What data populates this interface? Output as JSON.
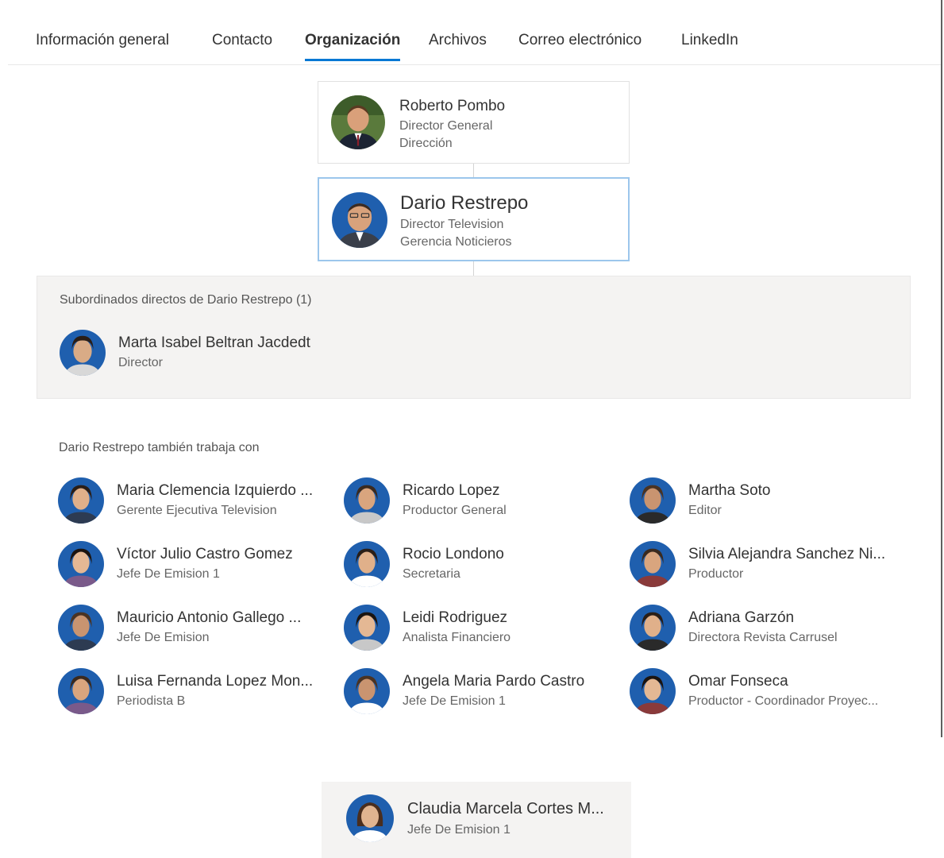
{
  "tabs": [
    {
      "label": "Información general"
    },
    {
      "label": "Contacto"
    },
    {
      "label": "Organización"
    },
    {
      "label": "Archivos"
    },
    {
      "label": "Correo electrónico"
    },
    {
      "label": "LinkedIn"
    }
  ],
  "active_tab": "Organización",
  "manager": {
    "name": "Roberto Pombo",
    "title": "Director General",
    "department": "Dirección"
  },
  "current": {
    "name": "Dario Restrepo",
    "title": "Director Television",
    "department": "Gerencia Noticieros"
  },
  "direct_reports": {
    "heading": "Subordinados directos de Dario Restrepo (1)",
    "items": [
      {
        "name": "Marta Isabel Beltran Jacdedt",
        "role": "Director"
      }
    ]
  },
  "works_with": {
    "heading": "Dario Restrepo también trabaja con",
    "items": [
      {
        "name": "Maria Clemencia Izquierdo ...",
        "role": "Gerente Ejecutiva Television"
      },
      {
        "name": "Ricardo Lopez",
        "role": "Productor General"
      },
      {
        "name": "Martha Soto",
        "role": "Editor"
      },
      {
        "name": "Víctor Julio Castro Gomez",
        "role": "Jefe De Emision 1"
      },
      {
        "name": "Rocio Londono",
        "role": "Secretaria"
      },
      {
        "name": "Silvia Alejandra Sanchez Ni...",
        "role": "Productor"
      },
      {
        "name": "Mauricio Antonio Gallego ...",
        "role": "Jefe De Emision"
      },
      {
        "name": "Leidi Rodriguez",
        "role": "Analista Financiero"
      },
      {
        "name": "Adriana Garzón",
        "role": "Directora Revista Carrusel"
      },
      {
        "name": "Luisa Fernanda Lopez Mon...",
        "role": "Periodista B"
      },
      {
        "name": "Angela Maria Pardo Castro",
        "role": "Jefe De Emision 1"
      },
      {
        "name": "Omar Fonseca",
        "role": "Productor - Coordinador Proyec..."
      }
    ]
  },
  "hover_card": {
    "name": "Claudia Marcela Cortes M...",
    "role": "Jefe De Emision 1"
  },
  "colors": {
    "accent": "#0078d4",
    "selected_border": "#9cc6ec",
    "panel_bg": "#f4f3f2",
    "avatar_bg": "#1f5fae"
  }
}
